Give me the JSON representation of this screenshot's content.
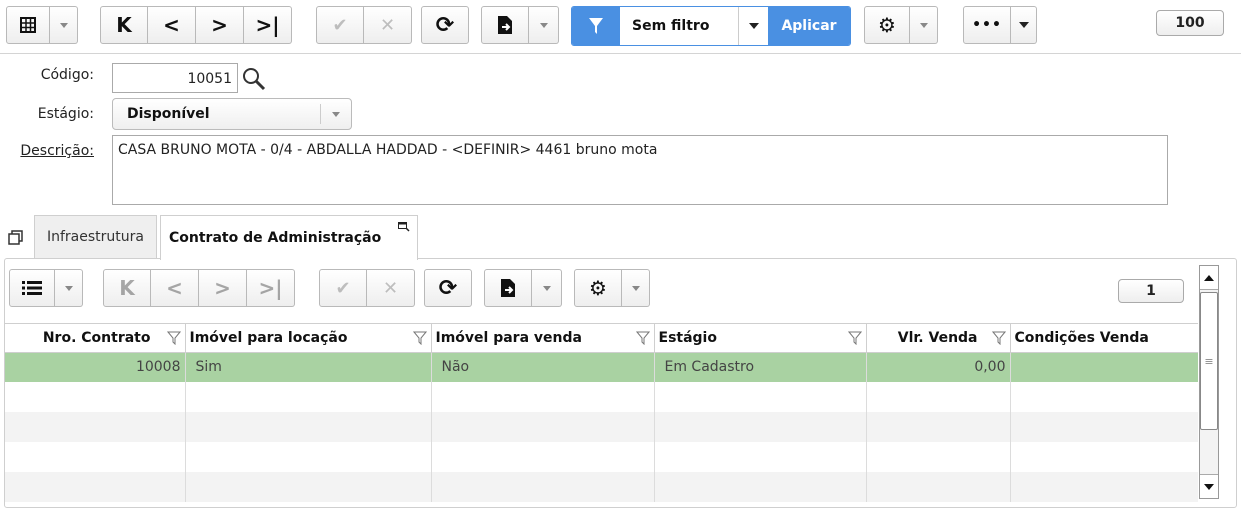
{
  "toolbar": {
    "filter_text": "Sem filtro",
    "apply_label": "Aplicar",
    "page_size": "100",
    "accent_color": "#4a90e2"
  },
  "form": {
    "codigo_label": "Código:",
    "codigo_value": "10051",
    "estagio_label": "Estágio:",
    "estagio_value": "Disponível",
    "descricao_label": "Descrição:",
    "descricao_value": "CASA BRUNO MOTA - 0/4 - ABDALLA HADDAD - <DEFINIR> 4461 bruno mota"
  },
  "tabs": [
    {
      "label": "Infraestrutura"
    },
    {
      "label": "Contrato de Administração"
    }
  ],
  "grid": {
    "page_size": "1",
    "columns": [
      "Nro. Contrato",
      "Imóvel para locação",
      "Imóvel para venda",
      "Estágio",
      "Vlr. Venda",
      "Condições Venda"
    ],
    "rows": [
      {
        "nro": "10008",
        "locacao": "Sim",
        "venda": "Não",
        "estagio": "Em Cadastro",
        "vlr": "0,00",
        "condicoes": ""
      }
    ],
    "selected_row_color": "#a9d2a2"
  },
  "icons": [
    "grid-view-icon",
    "first-icon",
    "prev-icon",
    "next-icon",
    "last-icon",
    "confirm-icon",
    "cancel-icon",
    "refresh-icon",
    "export-icon",
    "filter-icon",
    "gear-icon",
    "more-icon",
    "list-view-icon",
    "restore-icon",
    "search-icon",
    "maximize-icon"
  ]
}
